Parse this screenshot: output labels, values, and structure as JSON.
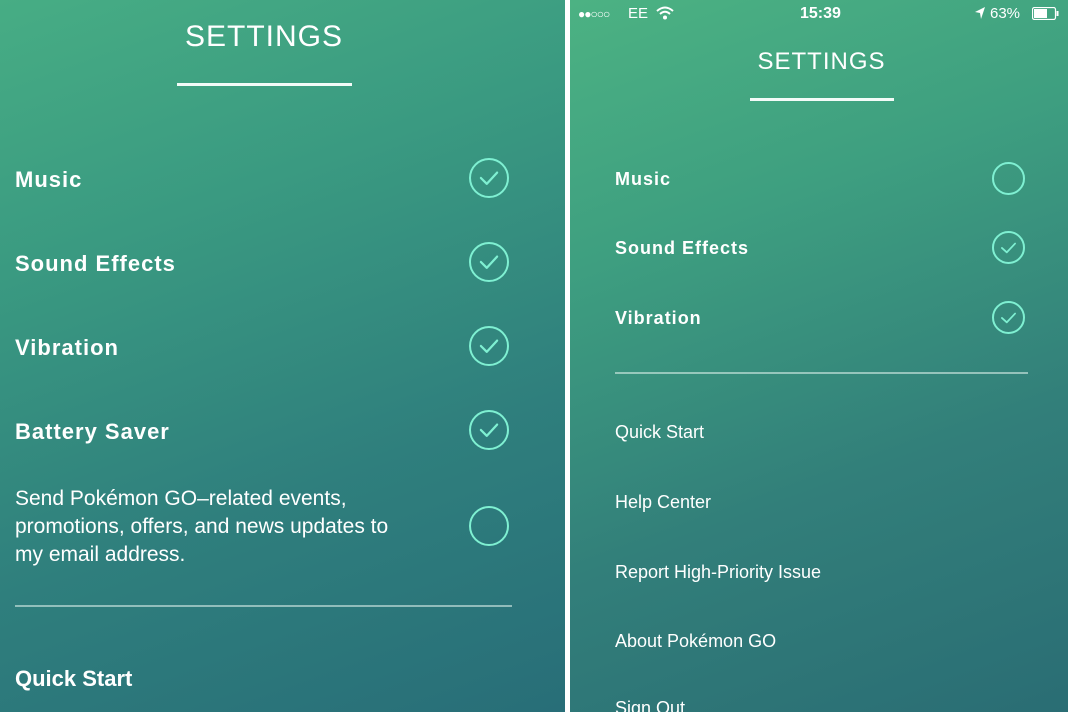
{
  "left": {
    "title": "SETTINGS",
    "toggles": [
      {
        "label": "Music",
        "checked": true
      },
      {
        "label": "Sound Effects",
        "checked": true
      },
      {
        "label": "Vibration",
        "checked": true
      },
      {
        "label": "Battery Saver",
        "checked": true
      }
    ],
    "email_optin": {
      "line1": "Send Pokémon GO–related events,",
      "line2": "promotions, offers, and news updates to",
      "line3": "my email address.",
      "checked": false
    },
    "links": [
      "Quick Start"
    ]
  },
  "right": {
    "status_bar": {
      "signal": "●●○○○",
      "carrier": "EE",
      "time": "15:39",
      "battery": "63%"
    },
    "title": "SETTINGS",
    "toggles": [
      {
        "label": "Music",
        "checked": false
      },
      {
        "label": "Sound Effects",
        "checked": true
      },
      {
        "label": "Vibration",
        "checked": true
      }
    ],
    "links": [
      "Quick Start",
      "Help Center",
      "Report High-Priority Issue",
      "About Pokémon GO",
      "Sign Out"
    ]
  },
  "colors": {
    "accent": "#7ff0d2",
    "gradient_top": "#47ad84",
    "gradient_bottom": "#286e78"
  },
  "icons": {
    "checked": "check-circle-icon",
    "unchecked": "empty-circle-icon",
    "wifi": "wifi-icon",
    "location": "location-arrow-icon",
    "battery": "battery-icon"
  }
}
